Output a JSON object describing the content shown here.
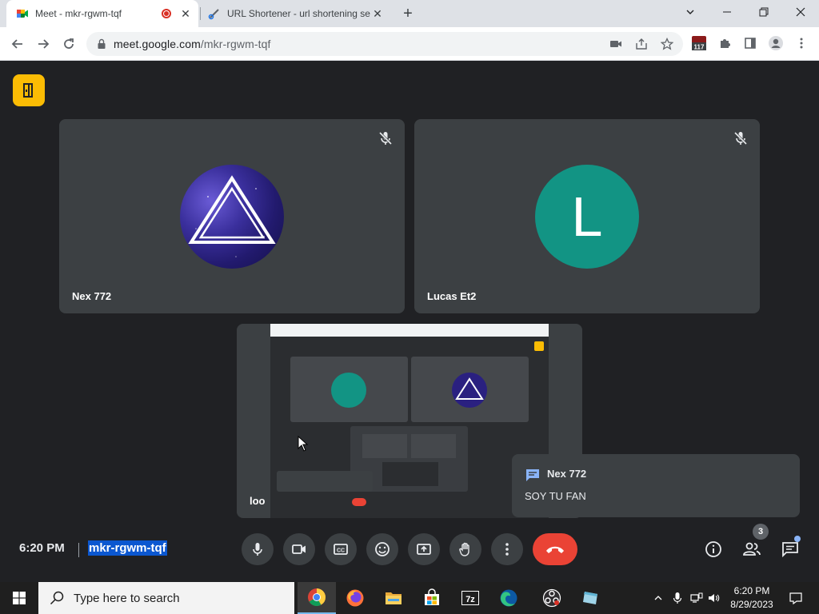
{
  "browser": {
    "tabs": [
      {
        "title": "Meet - mkr-rgwm-tqf",
        "active": true,
        "recording": true
      },
      {
        "title": "URL Shortener - url shortening se",
        "active": false
      }
    ],
    "url_host": "meet.google.com",
    "url_path": "/mkr-rgwm-tqf",
    "extension_badge": "117"
  },
  "meet": {
    "participants": [
      {
        "name": "Nex 772",
        "avatar": "nebula-triangle",
        "muted": true
      },
      {
        "name": "Lucas Et2",
        "avatar_letter": "L",
        "avatar_color": "#129484",
        "muted": true
      }
    ],
    "presenter_label": "loo",
    "chat_toast": {
      "sender": "Nex 772",
      "message": "SOY TU FAN"
    },
    "time": "6:20 PM",
    "meeting_code": "mkr-rgwm-tqf",
    "people_count": "3",
    "end_call_color": "#ea4335",
    "accent": "#0b57d0"
  },
  "taskbar": {
    "search_placeholder": "Type here to search",
    "clock_time": "6:20 PM",
    "clock_date": "8/29/2023"
  }
}
